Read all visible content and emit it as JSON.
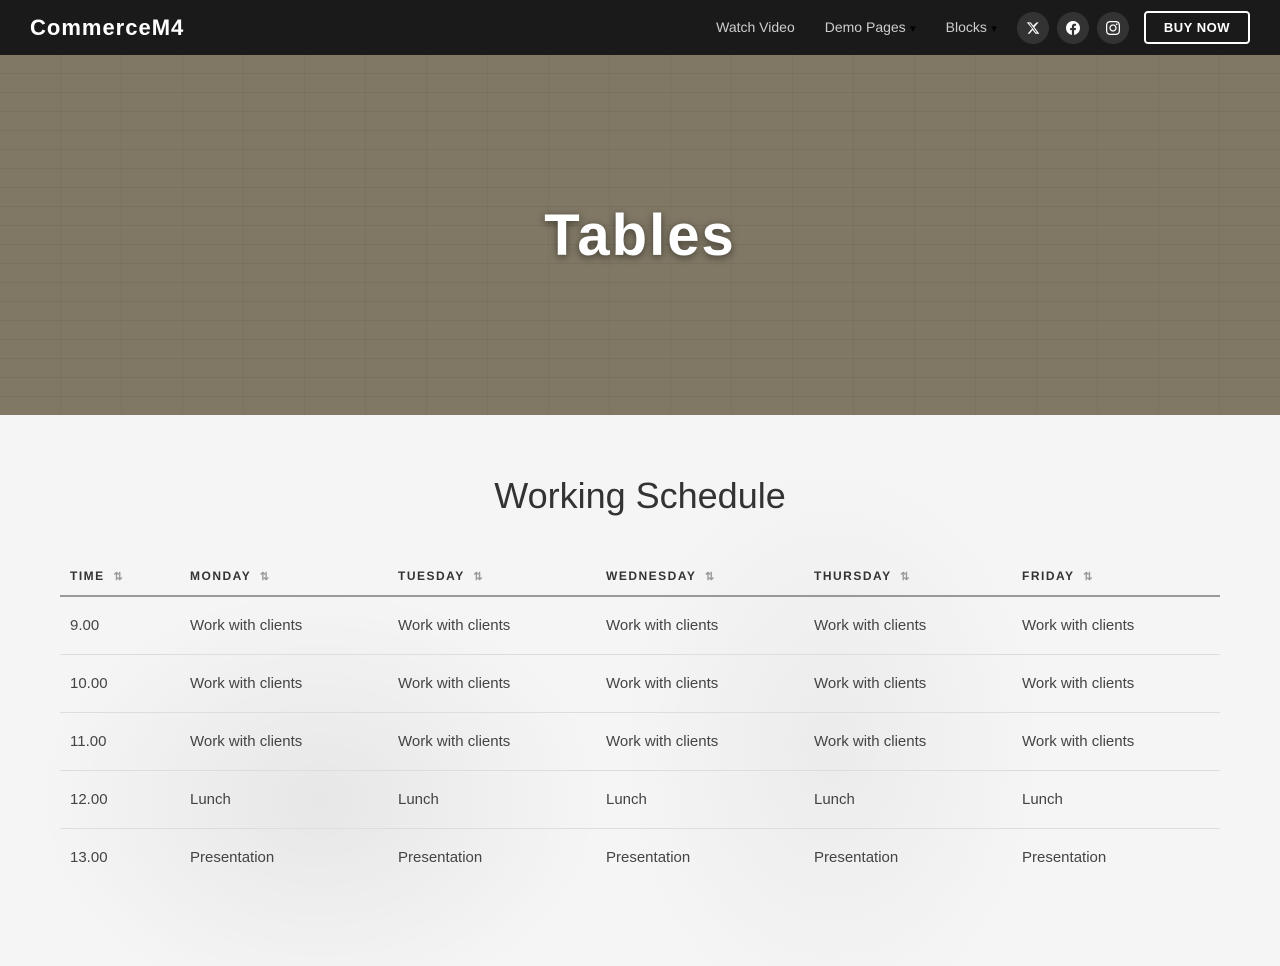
{
  "nav": {
    "brand": "CommerceM4",
    "links": [
      {
        "label": "Watch Video",
        "has_dropdown": false
      },
      {
        "label": "Demo Pages",
        "has_dropdown": true
      },
      {
        "label": "Blocks",
        "has_dropdown": true
      }
    ],
    "social": [
      {
        "name": "twitter",
        "icon": "𝕏"
      },
      {
        "name": "facebook",
        "icon": "f"
      },
      {
        "name": "instagram",
        "icon": "📷"
      }
    ],
    "buy_label": "BUY NOW"
  },
  "hero": {
    "title": "Tables"
  },
  "schedule": {
    "heading": "Working Schedule",
    "columns": [
      {
        "label": "TIME",
        "sortable": true
      },
      {
        "label": "MONDAY",
        "sortable": true
      },
      {
        "label": "TUESDAY",
        "sortable": true
      },
      {
        "label": "WEDNESDAY",
        "sortable": true
      },
      {
        "label": "THURSDAY",
        "sortable": true
      },
      {
        "label": "FRIDAY",
        "sortable": true
      }
    ],
    "rows": [
      {
        "time": "9.00",
        "monday": "Work with clients",
        "tuesday": "Work with clients",
        "wednesday": "Work with clients",
        "thursday": "Work with clients",
        "friday": "Work with clients"
      },
      {
        "time": "10.00",
        "monday": "Work with clients",
        "tuesday": "Work with clients",
        "wednesday": "Work with clients",
        "thursday": "Work with clients",
        "friday": "Work with clients"
      },
      {
        "time": "11.00",
        "monday": "Work with clients",
        "tuesday": "Work with clients",
        "wednesday": "Work with clients",
        "thursday": "Work with clients",
        "friday": "Work with clients"
      },
      {
        "time": "12.00",
        "monday": "Lunch",
        "tuesday": "Lunch",
        "wednesday": "Lunch",
        "thursday": "Lunch",
        "friday": "Lunch"
      },
      {
        "time": "13.00",
        "monday": "Presentation",
        "tuesday": "Presentation",
        "wednesday": "Presentation",
        "thursday": "Presentation",
        "friday": "Presentation"
      }
    ]
  }
}
